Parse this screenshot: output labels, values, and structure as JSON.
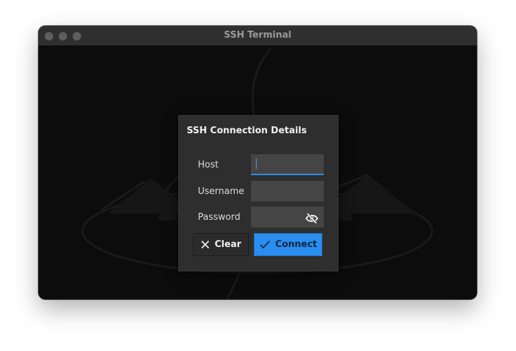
{
  "window": {
    "title": "SSH Terminal"
  },
  "dialog": {
    "title": "SSH Connection Details",
    "fields": {
      "host": {
        "label": "Host",
        "value": "",
        "placeholder": ""
      },
      "username": {
        "label": "Username",
        "value": "",
        "placeholder": ""
      },
      "password": {
        "label": "Password",
        "value": "",
        "placeholder": ""
      }
    },
    "buttons": {
      "clear": {
        "label": "Clear",
        "icon": "close-icon"
      },
      "connect": {
        "label": "Connect",
        "icon": "check-icon"
      }
    },
    "password_toggle_icon": "eye-off-icon"
  },
  "colors": {
    "accent": "#2a8ef0",
    "background": "#0c0c0c",
    "dialog": "#2e2e2e",
    "input": "#454545"
  }
}
